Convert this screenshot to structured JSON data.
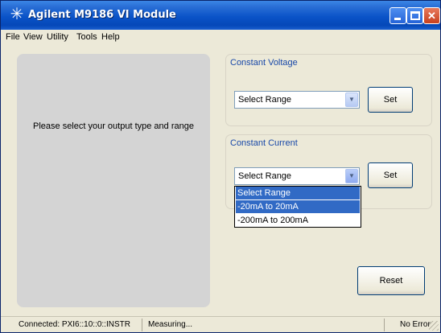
{
  "window": {
    "title": "Agilent M9186 VI Module",
    "icon": "agilent-spark-icon"
  },
  "menu": [
    "File",
    "View",
    "Utility",
    "Tools",
    "Help"
  ],
  "left_panel": {
    "message": "Please select your output type and range"
  },
  "constant_voltage": {
    "title": "Constant  Voltage",
    "combo_value": "Select Range",
    "set_label": "Set"
  },
  "constant_current": {
    "title": "Constant  Current",
    "combo_value": "Select Range",
    "set_label": "Set",
    "dropdown_options": [
      "Select Range",
      "-20mA to 20mA",
      "-200mA to 200mA"
    ],
    "highlighted_option": "-20mA to 20mA"
  },
  "reset_label": "Reset",
  "status": {
    "connection": "Connected: PXI6::10::0::INSTR",
    "state": "Measuring...",
    "error": "No Error"
  },
  "colors": {
    "titlebar": "#0a53c8",
    "group_title": "#1848a8",
    "selection": "#316ac5",
    "left_panel": "#d4d4d4"
  }
}
